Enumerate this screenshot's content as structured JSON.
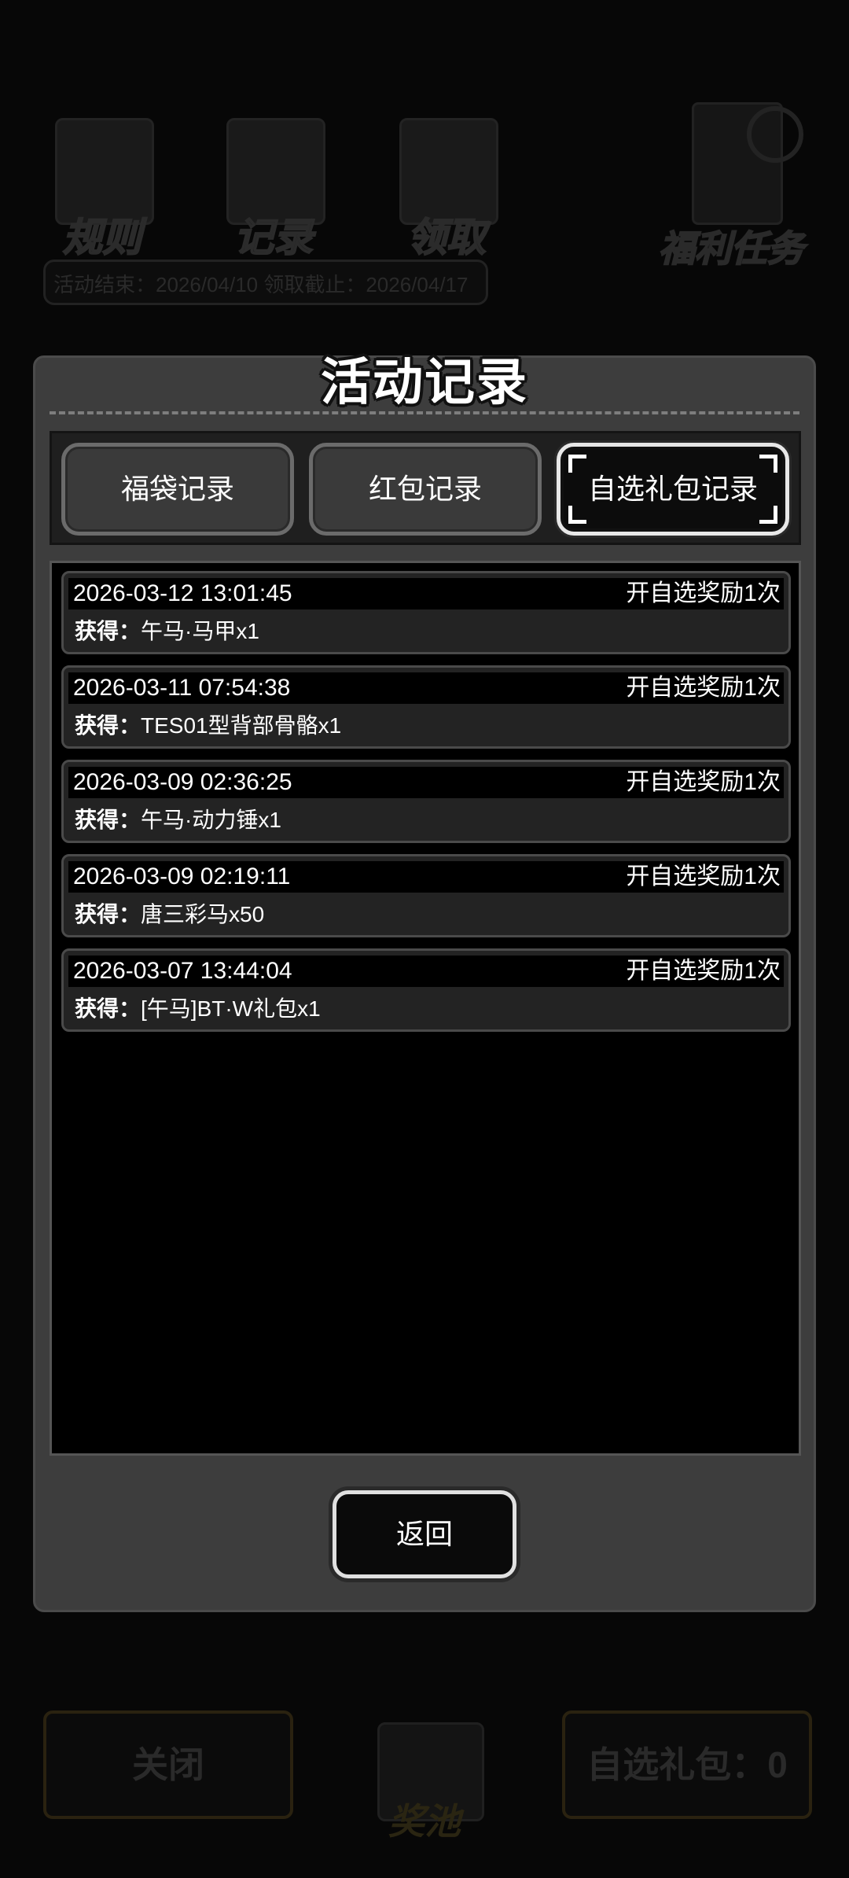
{
  "background": {
    "top_buttons": [
      {
        "label": "规则",
        "icon": "book-icon"
      },
      {
        "label": "记录",
        "icon": "clipboard-icon"
      },
      {
        "label": "领取",
        "icon": "package-icon"
      }
    ],
    "dates": "活动结束：2026/04/10  领取截止：2026/04/17",
    "task_button": "福利任务",
    "close_button": "关闭",
    "pool_label": "奖池",
    "optional_pack": "自选礼包：0"
  },
  "modal": {
    "title": "活动记录",
    "tabs": [
      {
        "label": "福袋记录",
        "active": false
      },
      {
        "label": "红包记录",
        "active": false
      },
      {
        "label": "自选礼包记录",
        "active": true
      }
    ],
    "records": [
      {
        "time": "2026-03-12 13:01:45",
        "action": "开自选奖励1次",
        "key": "获得：",
        "item": "午马·马甲x1"
      },
      {
        "time": "2026-03-11 07:54:38",
        "action": "开自选奖励1次",
        "key": "获得：",
        "item": "TES01型背部骨骼x1"
      },
      {
        "time": "2026-03-09 02:36:25",
        "action": "开自选奖励1次",
        "key": "获得：",
        "item": "午马·动力锤x1"
      },
      {
        "time": "2026-03-09 02:19:11",
        "action": "开自选奖励1次",
        "key": "获得：",
        "item": "唐三彩马x50"
      },
      {
        "time": "2026-03-07 13:44:04",
        "action": "开自选奖励1次",
        "key": "获得：",
        "item": "[午马]BT·W礼包x1"
      }
    ],
    "back_label": "返回"
  }
}
